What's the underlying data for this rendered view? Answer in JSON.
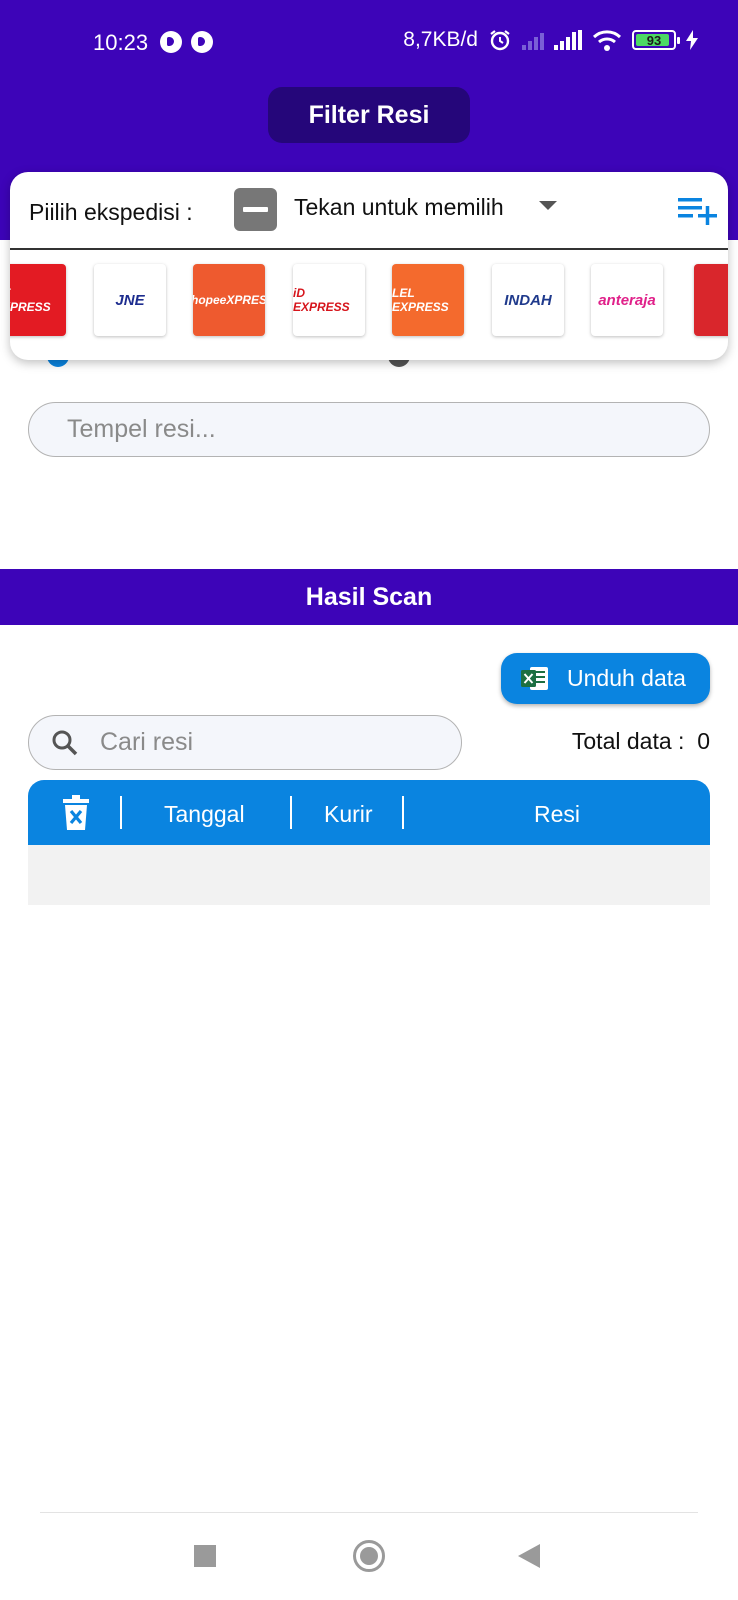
{
  "status_bar": {
    "time": "10:23",
    "network_rate": "8,7KB/d",
    "battery": "93"
  },
  "header": {
    "filter_button": "Filter Resi"
  },
  "expedition_card": {
    "label": "Piilih ekspedisi :",
    "selector_text": "Tekan untuk memilih",
    "logos": [
      {
        "name": "J&T Express",
        "text": "&T EXPRESS",
        "bg": "#e31b23",
        "fg": "#ffffff"
      },
      {
        "name": "JNE",
        "text": "JNE",
        "bg": "#ffffff",
        "fg": "#1d2d8f"
      },
      {
        "name": "Shopee Xpress",
        "text": "ShopeeXPRESS",
        "bg": "#ee5a2f",
        "fg": "#ffffff"
      },
      {
        "name": "ID Express",
        "text": "iD EXPRESS",
        "bg": "#ffffff",
        "fg": "#d6141b"
      },
      {
        "name": "Lion Express",
        "text": "LEL EXPRESS",
        "bg": "#f46a2d",
        "fg": "#ffffff"
      },
      {
        "name": "Indah Cargo",
        "text": "INDAH",
        "bg": "#ffffff",
        "fg": "#1f3a8c"
      },
      {
        "name": "Anteraja",
        "text": "anteraja",
        "bg": "#ffffff",
        "fg": "#e0218a"
      },
      {
        "name": "partial",
        "text": "",
        "bg": "#d9262c",
        "fg": "#ffffff"
      }
    ]
  },
  "paste_input": {
    "placeholder": "Tempel resi..."
  },
  "results": {
    "section_title": "Hasil Scan",
    "download_button": "Unduh data",
    "search_placeholder": "Cari resi",
    "total_label": "Total data :",
    "total_value": "0",
    "columns": [
      "Tanggal",
      "Kurir",
      "Resi"
    ]
  },
  "icons": {
    "add_list": "playlist-add-icon",
    "delete_all": "trash-icon",
    "excel": "excel-icon",
    "search": "search-icon"
  },
  "colors": {
    "primary_purple": "#3d04b8",
    "filter_button": "#25067a",
    "accent_blue": "#0a84e0"
  }
}
